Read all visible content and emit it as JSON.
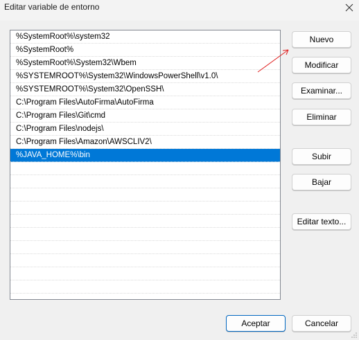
{
  "window": {
    "title": "Editar variable de entorno"
  },
  "list": {
    "items": [
      "%SystemRoot%\\system32",
      "%SystemRoot%",
      "%SystemRoot%\\System32\\Wbem",
      "%SYSTEMROOT%\\System32\\WindowsPowerShell\\v1.0\\",
      "%SYSTEMROOT%\\System32\\OpenSSH\\",
      "C:\\Program Files\\AutoFirma\\AutoFirma",
      "C:\\Program Files\\Git\\cmd",
      "C:\\Program Files\\nodejs\\",
      "C:\\Program Files\\Amazon\\AWSCLIV2\\",
      "%JAVA_HOME%\\bin"
    ],
    "selected_index": 9
  },
  "buttons": {
    "new": "Nuevo",
    "edit": "Modificar",
    "browse": "Examinar...",
    "delete": "Eliminar",
    "up": "Subir",
    "down": "Bajar",
    "edit_text": "Editar texto...",
    "accept": "Aceptar",
    "cancel": "Cancelar"
  },
  "colors": {
    "selection": "#0078d7",
    "annotation_arrow": "#e02020"
  }
}
